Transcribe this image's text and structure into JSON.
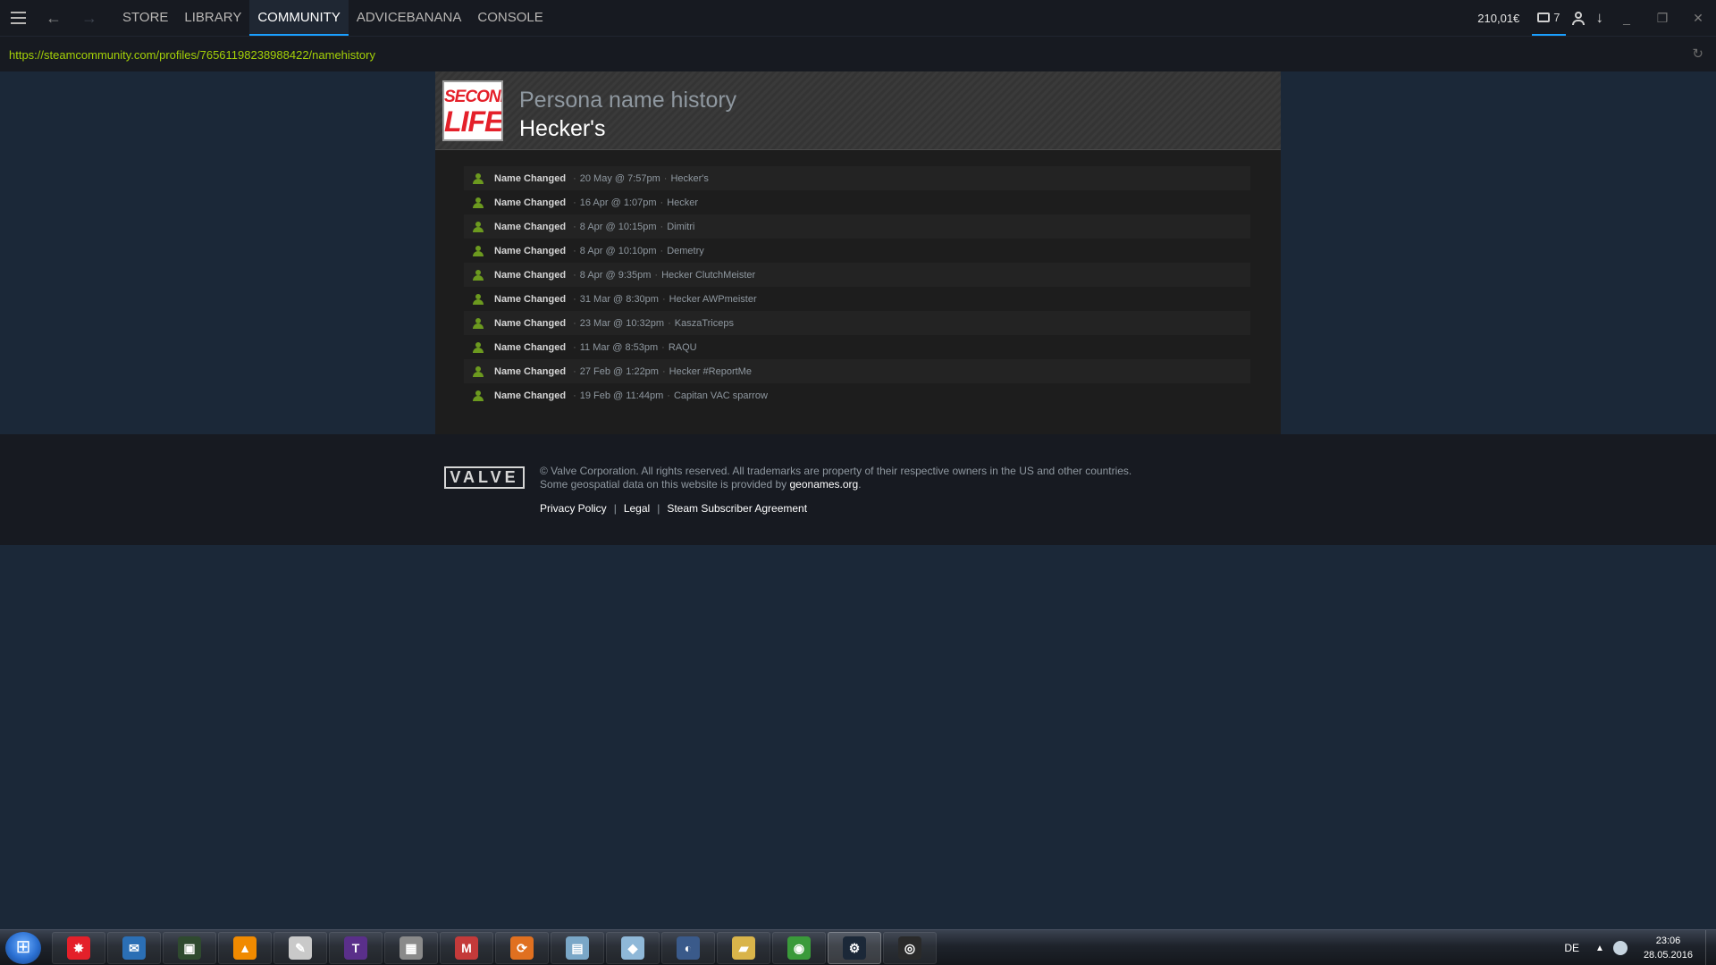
{
  "titlebar": {
    "tabs": [
      {
        "label": "STORE",
        "active": false
      },
      {
        "label": "LIBRARY",
        "active": false
      },
      {
        "label": "COMMUNITY",
        "active": true
      },
      {
        "label": "ADVICEBANANA",
        "active": false
      },
      {
        "label": "CONSOLE",
        "active": false
      }
    ],
    "balance": "210,01€",
    "notifications_count": "7"
  },
  "urlbar": {
    "url": "https://steamcommunity.com/profiles/76561198238988422/namehistory"
  },
  "profile": {
    "avatar_line1": "SECOND",
    "avatar_line2": "LIFE",
    "subtitle": "Persona name history",
    "name": "Hecker's"
  },
  "history": [
    {
      "label": "Name Changed",
      "date": "20 May @ 7:57pm",
      "name": "Hecker's"
    },
    {
      "label": "Name Changed",
      "date": "16 Apr @ 1:07pm",
      "name": "Hecker"
    },
    {
      "label": "Name Changed",
      "date": "8 Apr @ 10:15pm",
      "name": "Dimitri"
    },
    {
      "label": "Name Changed",
      "date": "8 Apr @ 10:10pm",
      "name": "Demetry"
    },
    {
      "label": "Name Changed",
      "date": "8 Apr @ 9:35pm",
      "name": "Hecker ClutchMeister"
    },
    {
      "label": "Name Changed",
      "date": "31 Mar @ 8:30pm",
      "name": "Hecker AWPmeister"
    },
    {
      "label": "Name Changed",
      "date": "23 Mar @ 10:32pm",
      "name": "KaszaTriceps"
    },
    {
      "label": "Name Changed",
      "date": "11 Mar @ 8:53pm",
      "name": "RAQU"
    },
    {
      "label": "Name Changed",
      "date": "27 Feb @ 1:22pm",
      "name": "Hecker #ReportMe"
    },
    {
      "label": "Name Changed",
      "date": "19 Feb @ 11:44pm",
      "name": "Capitan VAC sparrow"
    }
  ],
  "footer": {
    "logo_text": "VALVE",
    "legal_line1": "© Valve Corporation. All rights reserved. All trademarks are property of their respective owners in the US and other countries.",
    "legal_line2_prefix": "Some geospatial data on this website is provided by ",
    "legal_line2_link": "geonames.org",
    "legal_line2_suffix": ".",
    "links": [
      "Privacy Policy",
      "Legal",
      "Steam Subscriber Agreement"
    ]
  },
  "taskbar": {
    "items": [
      {
        "icon": "red-star-app-icon",
        "glyph": "✸",
        "color": "#e4202a"
      },
      {
        "icon": "thunderbird-icon",
        "glyph": "✉",
        "color": "#2b6fb5"
      },
      {
        "icon": "terminal-icon",
        "glyph": "▣",
        "color": "#2f4a2f"
      },
      {
        "icon": "vlc-icon",
        "glyph": "▲",
        "color": "#f08a00"
      },
      {
        "icon": "notepad-icon",
        "glyph": "✎",
        "color": "#c9c9c9"
      },
      {
        "icon": "texmaker-icon",
        "glyph": "T",
        "color": "#5a2f8a"
      },
      {
        "icon": "qr-tool-icon",
        "glyph": "▦",
        "color": "#8a8a8a"
      },
      {
        "icon": "mail-m-icon",
        "glyph": "M",
        "color": "#c43a3a"
      },
      {
        "icon": "sync-icon",
        "glyph": "⟳",
        "color": "#e07020"
      },
      {
        "icon": "calculator-icon",
        "glyph": "▤",
        "color": "#7aa7c7"
      },
      {
        "icon": "paper-icon",
        "glyph": "◆",
        "color": "#8fb8d8"
      },
      {
        "icon": "media-player-icon",
        "glyph": "◐",
        "color": "#3a5a8a"
      },
      {
        "icon": "file-explorer-icon",
        "glyph": "▰",
        "color": "#d9b44a"
      },
      {
        "icon": "chrome-icon",
        "glyph": "◉",
        "color": "#3a9a3a"
      },
      {
        "icon": "steam-icon",
        "glyph": "⚙",
        "color": "#1b2838"
      },
      {
        "icon": "obs-icon",
        "glyph": "◎",
        "color": "#2a2a2a"
      }
    ],
    "active_index": 14,
    "language": "DE",
    "time": "23:06",
    "date": "28.05.2016"
  }
}
